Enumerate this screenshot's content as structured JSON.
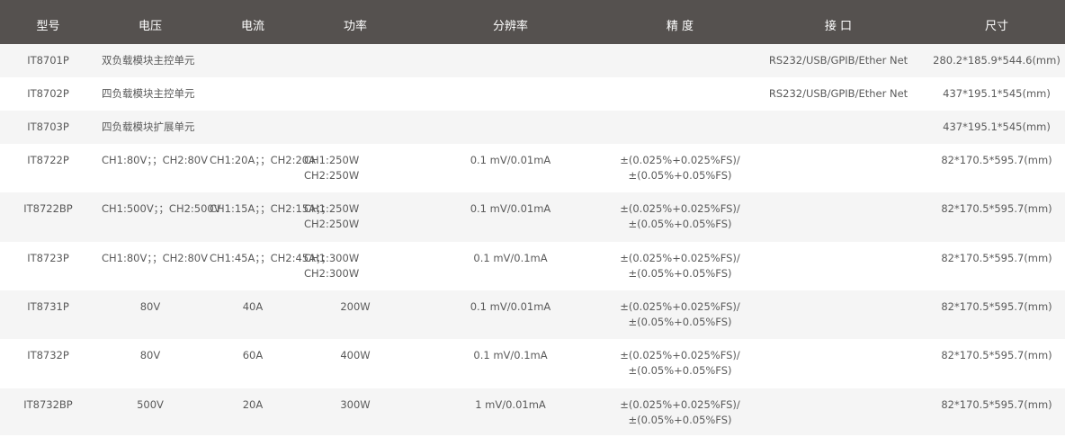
{
  "headers": {
    "model": "型号",
    "voltage": "电压",
    "current": "电流",
    "power": "功率",
    "resolution": "分辨率",
    "accuracy": "精 度",
    "interface": "接 口",
    "size": "尺寸"
  },
  "rows": [
    {
      "model": "IT8701P",
      "voltage": "双负载模块主控单元",
      "current": "",
      "power1": "",
      "power2": "",
      "resolution": "",
      "accuracy1": "",
      "accuracy2": "",
      "interface": "RS232/USB/GPIB/Ether Net",
      "size": "280.2*185.9*544.6(mm)"
    },
    {
      "model": "IT8702P",
      "voltage": "四负载模块主控单元",
      "current": "",
      "power1": "",
      "power2": "",
      "resolution": "",
      "accuracy1": "",
      "accuracy2": "",
      "interface": "RS232/USB/GPIB/Ether Net",
      "size": "437*195.1*545(mm)"
    },
    {
      "model": "IT8703P",
      "voltage": "四负载模块扩展单元",
      "current": "",
      "power1": "",
      "power2": "",
      "resolution": "",
      "accuracy1": "",
      "accuracy2": "",
      "interface": "",
      "size": "437*195.1*545(mm)"
    },
    {
      "model": "IT8722P",
      "voltage": "CH1:80V；；CH2:80V",
      "current": "CH1:20A；；CH2:20A",
      "power1": "CH1:250W",
      "power2": "CH2:250W",
      "resolution": "0.1 mV/0.01mA",
      "accuracy1": "±(0.025%+0.025%FS)/",
      "accuracy2": "±(0.05%+0.05%FS)",
      "interface": "",
      "size": "82*170.5*595.7(mm)"
    },
    {
      "model": "IT8722BP",
      "voltage": "CH1:500V；；CH2:500V",
      "current": "CH1:15A；；CH2:15A；；",
      "power1": "CH1:250W",
      "power2": "CH2:250W",
      "resolution": "0.1 mV/0.01mA",
      "accuracy1": "±(0.025%+0.025%FS)/",
      "accuracy2": "±(0.05%+0.05%FS)",
      "interface": "",
      "size": "82*170.5*595.7(mm)"
    },
    {
      "model": "IT8723P",
      "voltage": "CH1:80V；；CH2:80V",
      "current": "CH1:45A；；CH2:45A；；",
      "power1": "CH1:300W",
      "power2": "CH2:300W",
      "resolution": "0.1 mV/0.1mA",
      "accuracy1": "±(0.025%+0.025%FS)/",
      "accuracy2": "±(0.05%+0.05%FS)",
      "interface": "",
      "size": "82*170.5*595.7(mm)"
    },
    {
      "model": "IT8731P",
      "voltage": "80V",
      "current": "40A",
      "power1": "200W",
      "power2": "",
      "resolution": "0.1 mV/0.01mA",
      "accuracy1": "±(0.025%+0.025%FS)/",
      "accuracy2": "±(0.05%+0.05%FS)",
      "interface": "",
      "size": "82*170.5*595.7(mm)"
    },
    {
      "model": "IT8732P",
      "voltage": "80V",
      "current": "60A",
      "power1": "400W",
      "power2": "",
      "resolution": "0.1 mV/0.1mA",
      "accuracy1": "±(0.025%+0.025%FS)/",
      "accuracy2": "±(0.05%+0.05%FS)",
      "interface": "",
      "size": "82*170.5*595.7(mm)"
    },
    {
      "model": "IT8732BP",
      "voltage": "500V",
      "current": "20A",
      "power1": "300W",
      "power2": "",
      "resolution": "1 mV/0.01mA",
      "accuracy1": "±(0.025%+0.025%FS)/",
      "accuracy2": "±(0.05%+0.05%FS)",
      "interface": "",
      "size": "82*170.5*595.7(mm)"
    }
  ]
}
